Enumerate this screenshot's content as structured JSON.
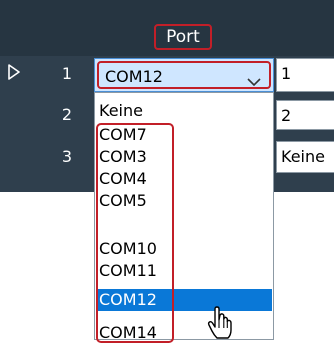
{
  "grid": {
    "column_header": "Port",
    "rows": [
      {
        "num": "1",
        "port": "COM12",
        "next": "1"
      },
      {
        "num": "2",
        "next": "2"
      },
      {
        "num": "3",
        "next": "Keine"
      }
    ]
  },
  "dropdown": {
    "options": [
      "Keine",
      "COM7",
      "COM3",
      "COM4",
      "COM5",
      "COM10",
      "COM11",
      "COM12",
      "COM14"
    ],
    "selected": "COM12"
  },
  "icons": {
    "row_indicator": "play-triangle-outline-icon",
    "combo_arrow": "chevron-down-icon",
    "cursor": "hand-pointer-cursor-icon"
  },
  "colors": {
    "panel": "#2f3f4d",
    "header_band": "#263541",
    "annotation_red": "#c21f28",
    "selection_blue": "#0a78d7",
    "combo_background": "#cfe6ff"
  }
}
